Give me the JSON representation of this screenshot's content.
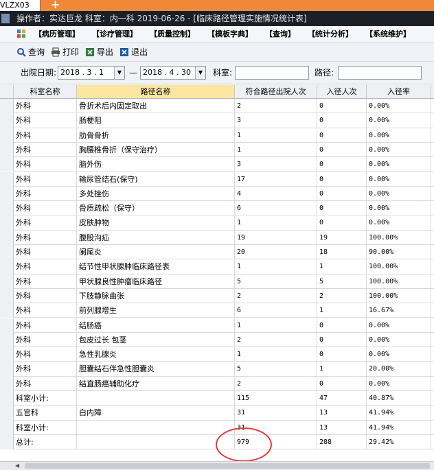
{
  "tab": {
    "label": "VLZX03",
    "add_label": "+"
  },
  "window": {
    "title": "操作者：实达巨龙 科室：内一科 2019-06-26 - [临床路径管理实施情况统计表]"
  },
  "menu": {
    "items": [
      "【病历管理】",
      "【诊疗管理】",
      "【质量控制】",
      "【模板字典】",
      "【查询】",
      "【统计分析】",
      "【系统维护】"
    ]
  },
  "toolbar": {
    "query_label": "查询",
    "print_label": "打印",
    "export_label": "导出",
    "exit_label": "退出"
  },
  "filter": {
    "discharge_label": "出院日期:",
    "date_from": "2018 . 3 . 1",
    "dash": "—",
    "date_to": "2018 . 4 . 30",
    "dept_label": "科室:",
    "dept_value": "",
    "path_label": "路径:",
    "path_value": ""
  },
  "table": {
    "headers": [
      "科室名称",
      "路径名称",
      "符合路径出院人次",
      "入径人次",
      "入径率"
    ],
    "rows": [
      [
        "外科",
        "骨折术后内固定取出",
        "2",
        "0",
        "0.00%"
      ],
      [
        "外科",
        "肠梗阻",
        "3",
        "0",
        "0.00%"
      ],
      [
        "外科",
        "肋骨骨折",
        "1",
        "0",
        "0.00%"
      ],
      [
        "外科",
        "胸腰椎骨折（保守治疗）",
        "1",
        "0",
        "0.00%"
      ],
      [
        "外科",
        "脑外伤",
        "3",
        "0",
        "0.00%"
      ],
      [
        "外科",
        "输尿管结石(保守)",
        "17",
        "0",
        "0.00%"
      ],
      [
        "外科",
        "多处挫伤",
        "4",
        "0",
        "0.00%"
      ],
      [
        "外科",
        "骨质疏松（保守）",
        "6",
        "0",
        "0.00%"
      ],
      [
        "外科",
        "皮肤肿物",
        "1",
        "0",
        "0.00%"
      ],
      [
        "外科",
        "腹股沟疝",
        "19",
        "19",
        "100.00%"
      ],
      [
        "外科",
        "阑尾炎",
        "20",
        "18",
        "90.00%"
      ],
      [
        "外科",
        "结节性甲状腺肿临床路径表",
        "1",
        "1",
        "100.00%"
      ],
      [
        "外科",
        "甲状腺良性肿瘤临床路径",
        "5",
        "5",
        "100.00%"
      ],
      [
        "外科",
        "下肢静脉曲张",
        "2",
        "2",
        "100.00%"
      ],
      [
        "外科",
        "前列腺增生",
        "6",
        "1",
        "16.67%"
      ],
      [
        "外科",
        "结肠癌",
        "1",
        "0",
        "0.00%"
      ],
      [
        "外科",
        "包皮过长 包茎",
        "2",
        "0",
        "0.00%"
      ],
      [
        "外科",
        "急性乳腺炎",
        "1",
        "0",
        "0.00%"
      ],
      [
        "外科",
        "胆囊结石伴急性胆囊炎",
        "5",
        "1",
        "20.00%"
      ],
      [
        "外科",
        "结直肠癌辅助化疗",
        "2",
        "0",
        "0.00%"
      ],
      [
        "科室小计:",
        "",
        "115",
        "47",
        "40.87%"
      ],
      [
        "五官科",
        "白内障",
        "31",
        "13",
        "41.94%"
      ],
      [
        "科室小计:",
        "",
        "31",
        "13",
        "41.94%"
      ],
      [
        "总计:",
        "",
        "979",
        "288",
        "29.42%"
      ]
    ]
  },
  "colors": {
    "tabstrip": "#f0883a",
    "titlebar": "#1b1f26",
    "header_active": "#fbe6a0",
    "annotation": "#e23b3b"
  }
}
